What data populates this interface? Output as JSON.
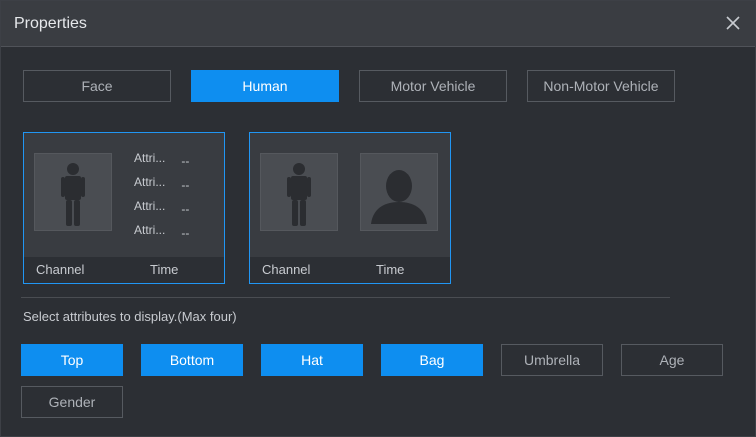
{
  "window": {
    "title": "Properties"
  },
  "tabs": [
    {
      "label": "Face",
      "active": false
    },
    {
      "label": "Human",
      "active": true
    },
    {
      "label": "Motor Vehicle",
      "active": false
    },
    {
      "label": "Non-Motor Vehicle",
      "active": false
    }
  ],
  "preview_cards": [
    {
      "attributes": [
        {
          "name": "Attri...",
          "value": "--"
        },
        {
          "name": "Attri...",
          "value": "--"
        },
        {
          "name": "Attri...",
          "value": "--"
        },
        {
          "name": "Attri...",
          "value": "--"
        }
      ],
      "footer": {
        "channel": "Channel",
        "time": "Time"
      }
    },
    {
      "footer": {
        "channel": "Channel",
        "time": "Time"
      }
    }
  ],
  "hint": "Select attributes to display.(Max four)",
  "attribute_buttons": [
    {
      "label": "Top",
      "selected": true
    },
    {
      "label": "Bottom",
      "selected": true
    },
    {
      "label": "Hat",
      "selected": true
    },
    {
      "label": "Bag",
      "selected": true
    },
    {
      "label": "Umbrella",
      "selected": false
    },
    {
      "label": "Age",
      "selected": false
    },
    {
      "label": "Gender",
      "selected": false
    }
  ],
  "colors": {
    "accent": "#0e8ef0",
    "card_border": "#2196f3"
  }
}
